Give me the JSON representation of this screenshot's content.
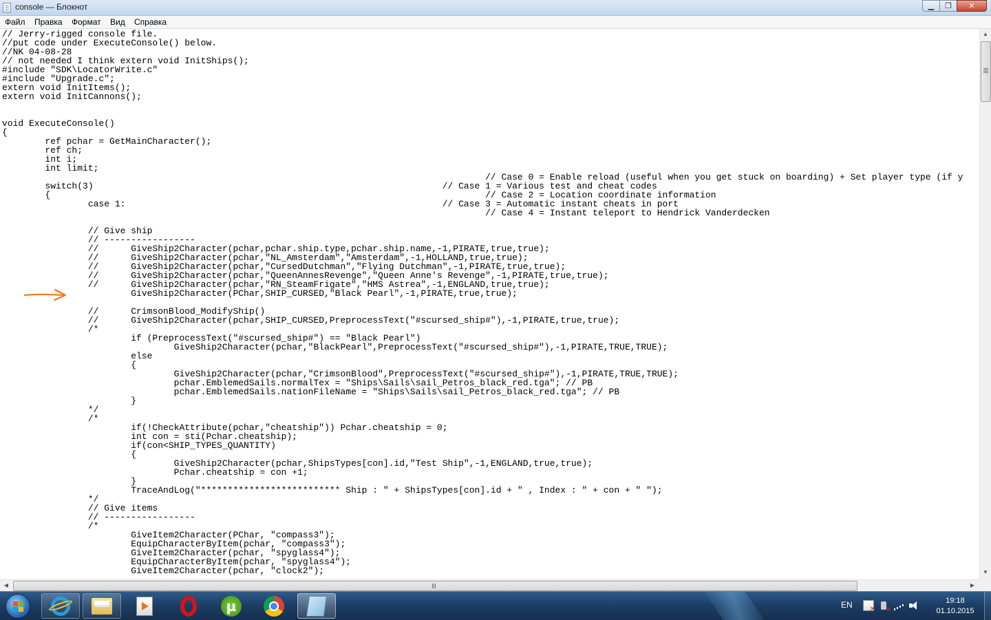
{
  "window": {
    "title": "console — Блокнот",
    "minimize_label": "▁",
    "maximize_label": "❐",
    "close_label": "✕"
  },
  "menu": {
    "file": "Файл",
    "edit": "Правка",
    "format": "Формат",
    "view": "Вид",
    "help": "Справка"
  },
  "editor": {
    "content": "// Jerry-rigged console file.\n//put code under ExecuteConsole() below.\n//NK 04-08-28\n// not needed I think extern void InitShips();\n#include \"SDK\\LocatorWrite.c\"\n#include \"Upgrade.c\";\nextern void InitItems();\nextern void InitCannons();\n\n\nvoid ExecuteConsole()\n{\n        ref pchar = GetMainCharacter();\n        ref ch;\n        int i;\n        int limit;\n                                                                                          // Case 0 = Enable reload (useful when you get stuck on boarding) + Set player type (if y\n        switch(3)                                                                 // Case 1 = Various test and cheat codes\n        {                                                                                 // Case 2 = Location coordinate information\n                case 1:                                                           // Case 3 = Automatic instant cheats in port\n                                                                                          // Case 4 = Instant teleport to Hendrick Vanderdecken\n\n                // Give ship\n                // -----------------\n                //      GiveShip2Character(pchar,pchar.ship.type,pchar.ship.name,-1,PIRATE,true,true);\n                //      GiveShip2Character(pchar,\"NL_Amsterdam\",\"Amsterdam\",-1,HOLLAND,true,true);\n                //      GiveShip2Character(pchar,\"CursedDutchman\",\"Flying Dutchman\",-1,PIRATE,true,true);\n                //      GiveShip2Character(pchar,\"QueenAnnesRevenge\",\"Queen Anne's Revenge\",-1,PIRATE,true,true);\n                //      GiveShip2Character(pchar,\"RN_SteamFrigate\",\"HMS Astrea\",-1,ENGLAND,true,true);\n                        GiveShip2Character(PChar,SHIP_CURSED,\"Black Pearl\",-1,PIRATE,true,true);\n\n                //      CrimsonBlood_ModifyShip()\n                //      GiveShip2Character(pchar,SHIP_CURSED,PreprocessText(\"#scursed_ship#\"),-1,PIRATE,true,true);\n                /*\n                        if (PreprocessText(\"#scursed_ship#\") == \"Black Pearl\")\n                                GiveShip2Character(pchar,\"BlackPearl\",PreprocessText(\"#scursed_ship#\"),-1,PIRATE,TRUE,TRUE);\n                        else\n                        {\n                                GiveShip2Character(pchar,\"CrimsonBlood\",PreprocessText(\"#scursed_ship#\"),-1,PIRATE,TRUE,TRUE);\n                                pchar.EmblemedSails.normalTex = \"Ships\\Sails\\sail_Petros_black_red.tga\"; // PB\n                                pchar.EmblemedSails.nationFileName = \"Ships\\Sails\\sail_Petros_black_red.tga\"; // PB\n                        }\n                */\n                /*\n                        if(!CheckAttribute(pchar,\"cheatship\")) Pchar.cheatship = 0;\n                        int con = sti(Pchar.cheatship);\n                        if(con<SHIP_TYPES_QUANTITY)\n                        {\n                                GiveShip2Character(pchar,ShipsTypes[con].id,\"Test Ship\",-1,ENGLAND,true,true);\n                                Pchar.cheatship = con +1;\n                        }\n                        TraceAndLog(\"************************** Ship : \" + ShipsTypes[con].id + \" , Index : \" + con + \" \");\n                */\n                // Give items\n                // -----------------\n                /*\n                        GiveItem2Character(PChar, \"compass3\");\n                        EquipCharacterByItem(pchar, \"compass3\");\n                        GiveItem2Character(pchar, \"spyglass4\");\n                        EquipCharacterByItem(pchar, \"spyglass4\");\n                        GiveItem2Character(pchar, \"clock2\");"
  },
  "scrollbars": {
    "up_arrow": "▲",
    "down_arrow": "▼",
    "left_arrow": "◀",
    "right_arrow": "▶"
  },
  "taskbar": {
    "language": "EN",
    "time": "19:18",
    "date": "01.10.2015",
    "torrent_glyph": "µ"
  },
  "colors": {
    "annotation_arrow": "#f07a24",
    "taskbar": "#1c3c62"
  }
}
